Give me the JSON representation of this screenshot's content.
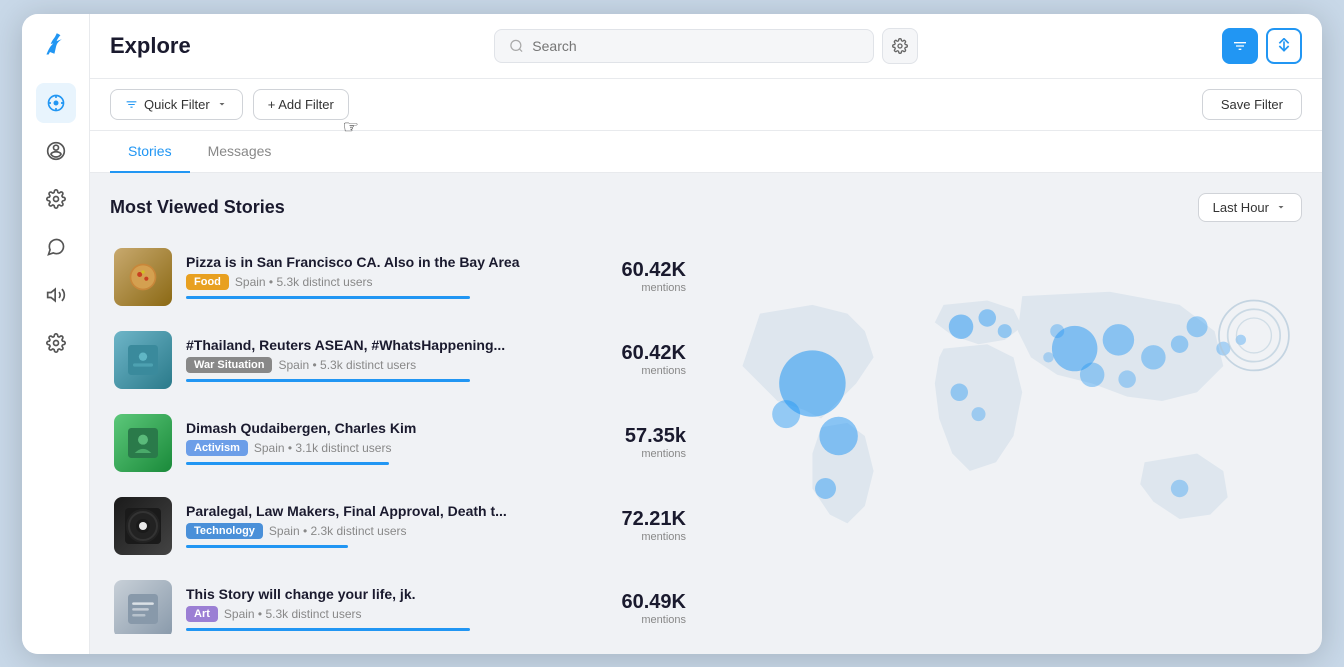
{
  "app": {
    "title": "Explore"
  },
  "header": {
    "search_placeholder": "Search",
    "filter_label": "Quick Filter",
    "add_filter_label": "+ Add Filter",
    "save_filter_label": "Save Filter"
  },
  "tabs": [
    {
      "id": "stories",
      "label": "Stories",
      "active": true
    },
    {
      "id": "messages",
      "label": "Messages",
      "active": false
    }
  ],
  "section": {
    "title": "Most Viewed Stories",
    "time_filter": "Last Hour"
  },
  "stories": [
    {
      "id": 1,
      "headline": "Pizza is in San Francisco CA. Also in the Bay Area",
      "tag": "Food",
      "tag_class": "tag-food",
      "location": "Spain • 5.3k distinct users",
      "mentions": "60.42K",
      "thumb_class": "thumb-pizza"
    },
    {
      "id": 2,
      "headline": "#Thailand, Reuters ASEAN, #WhatsHappening...",
      "tag": "War Situation",
      "tag_class": "tag-war",
      "location": "Spain • 5.3k distinct users",
      "mentions": "60.42K",
      "thumb_class": "thumb-thailand"
    },
    {
      "id": 3,
      "headline": "Dimash Qudaibergen, Charles Kim",
      "tag": "Activism",
      "tag_class": "tag-activism",
      "location": "Spain • 3.1k distinct users",
      "mentions": "57.35k",
      "thumb_class": "thumb-dimash"
    },
    {
      "id": 4,
      "headline": "Paralegal, Law Makers, Final Approval, Death t...",
      "tag": "Technology",
      "tag_class": "tag-technology",
      "location": "Spain • 2.3k distinct users",
      "mentions": "72.21K",
      "thumb_class": "thumb-paralegal"
    },
    {
      "id": 5,
      "headline": "This Story will change your life, jk.",
      "tag": "Art",
      "tag_class": "tag-art",
      "location": "Spain • 5.3k distinct users",
      "mentions": "60.49K",
      "thumb_class": "thumb-story"
    }
  ],
  "sidebar": {
    "items": [
      {
        "id": "logo",
        "icon": "leaf"
      },
      {
        "id": "explore",
        "icon": "explore",
        "active": true
      },
      {
        "id": "alert",
        "icon": "alert"
      },
      {
        "id": "settings1",
        "icon": "settings"
      },
      {
        "id": "megaphone",
        "icon": "megaphone"
      },
      {
        "id": "chat",
        "icon": "chat"
      },
      {
        "id": "settings2",
        "icon": "settings2"
      }
    ]
  },
  "icons": {
    "search": "🔍",
    "gear": "⚙",
    "filter": "▼",
    "sort": "↕",
    "chevron_down": "▾",
    "plus": "+"
  }
}
